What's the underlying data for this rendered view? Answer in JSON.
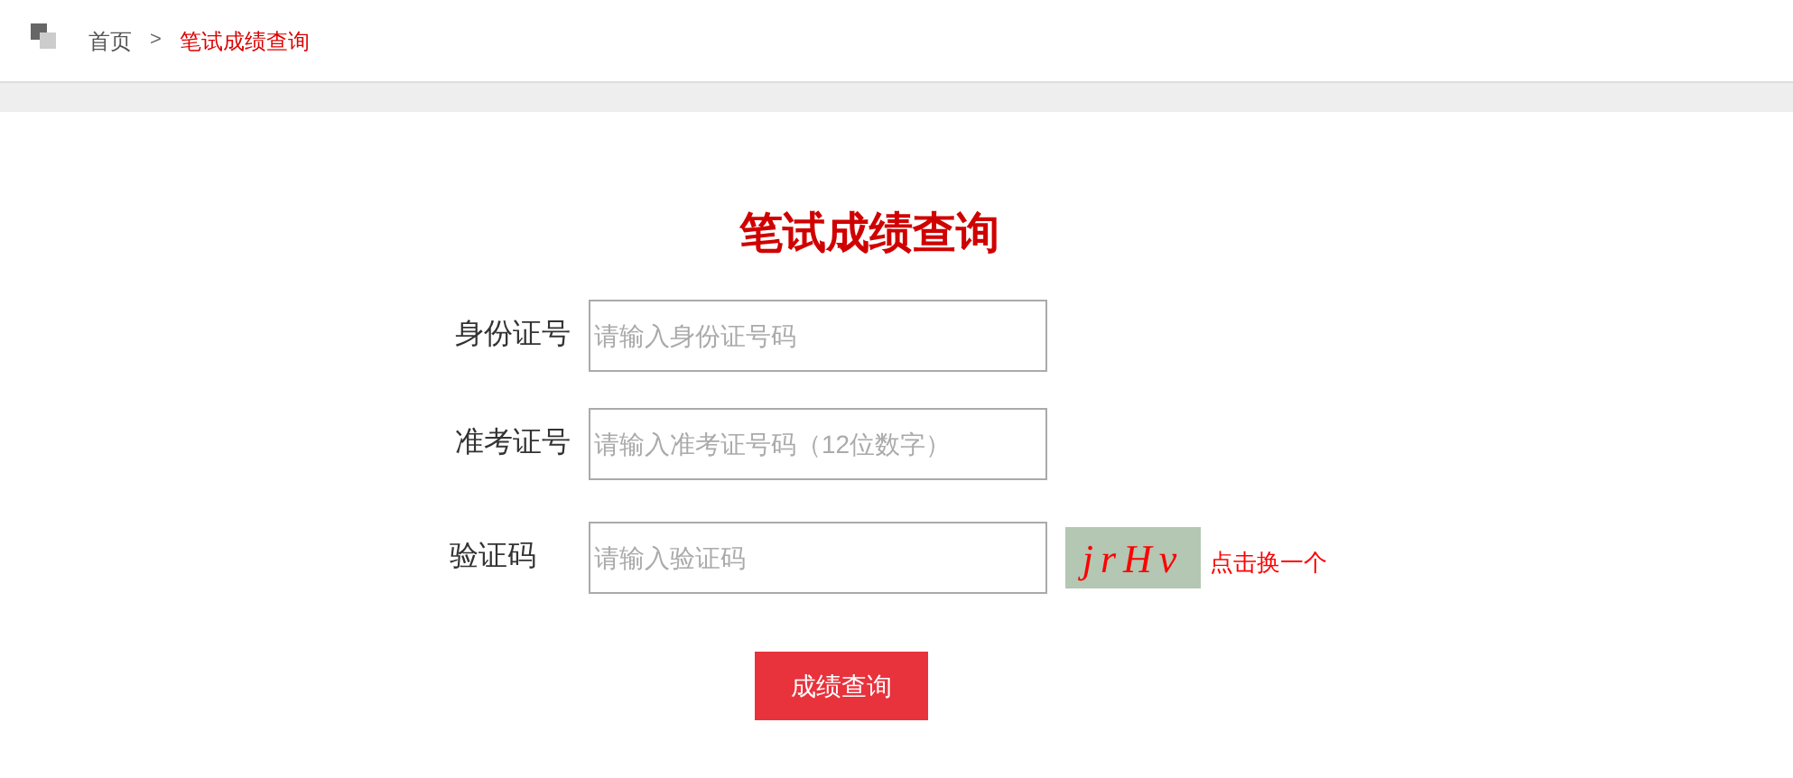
{
  "breadcrumb": {
    "items": [
      {
        "label": "首页",
        "selected": false
      },
      {
        "label": "笔试成绩查询",
        "selected": true
      }
    ],
    "separator": ">"
  },
  "title": "笔试成绩查询",
  "fields": [
    {
      "label": "身份证号",
      "placeholder": "请输入身份证号码"
    },
    {
      "label": "准考证号",
      "placeholder": "请输入准考证号码（12位数字）"
    },
    {
      "label": "验证码",
      "placeholder": "请输入验证码",
      "captcha": "jrHv",
      "refresh": "点击换一个"
    }
  ],
  "submit": "成绩查询"
}
